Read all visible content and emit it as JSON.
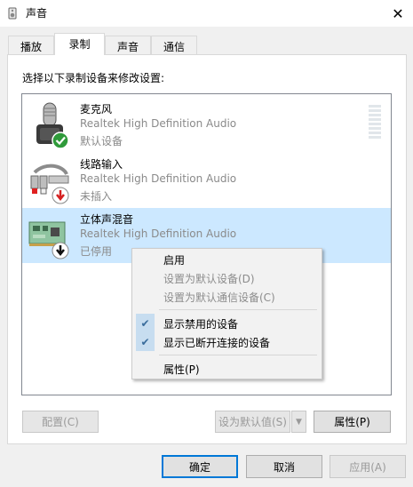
{
  "window": {
    "title": "声音",
    "close_glyph": "✕"
  },
  "tabs": [
    {
      "label": "播放",
      "active": false
    },
    {
      "label": "录制",
      "active": true
    },
    {
      "label": "声音",
      "active": false
    },
    {
      "label": "通信",
      "active": false
    }
  ],
  "panel": {
    "instruction": "选择以下录制设备来修改设置:"
  },
  "devices": [
    {
      "name": "麦克风",
      "driver": "Realtek High Definition Audio",
      "status": "默认设备",
      "icon": "microphone-icon",
      "badge": "green-check",
      "selected": false
    },
    {
      "name": "线路输入",
      "driver": "Realtek High Definition Audio",
      "status": "未插入",
      "icon": "line-in-icon",
      "badge": "red-down-arrow",
      "selected": false
    },
    {
      "name": "立体声混音",
      "driver": "Realtek High Definition Audio",
      "status": "已停用",
      "icon": "sound-card-icon",
      "badge": "black-down-arrow",
      "selected": true
    }
  ],
  "context_menu": [
    {
      "label": "启用",
      "enabled": true,
      "checked": false
    },
    {
      "label": "设置为默认设备(D)",
      "enabled": false,
      "checked": false
    },
    {
      "label": "设置为默认通信设备(C)",
      "enabled": false,
      "checked": false
    },
    {
      "label": "显示禁用的设备",
      "enabled": true,
      "checked": true
    },
    {
      "label": "显示已断开连接的设备",
      "enabled": true,
      "checked": true
    },
    {
      "label": "属性(P)",
      "enabled": true,
      "checked": false
    }
  ],
  "panel_buttons": {
    "configure": "配置(C)",
    "set_default": "设为默认值(S)",
    "properties": "属性(P)"
  },
  "dialog_buttons": {
    "ok": "确定",
    "cancel": "取消",
    "apply": "应用(A)"
  },
  "colors": {
    "selection": "#cce8ff",
    "accent": "#0078d7",
    "check_green": "#2f9a3a",
    "arrow_red": "#d42020"
  }
}
